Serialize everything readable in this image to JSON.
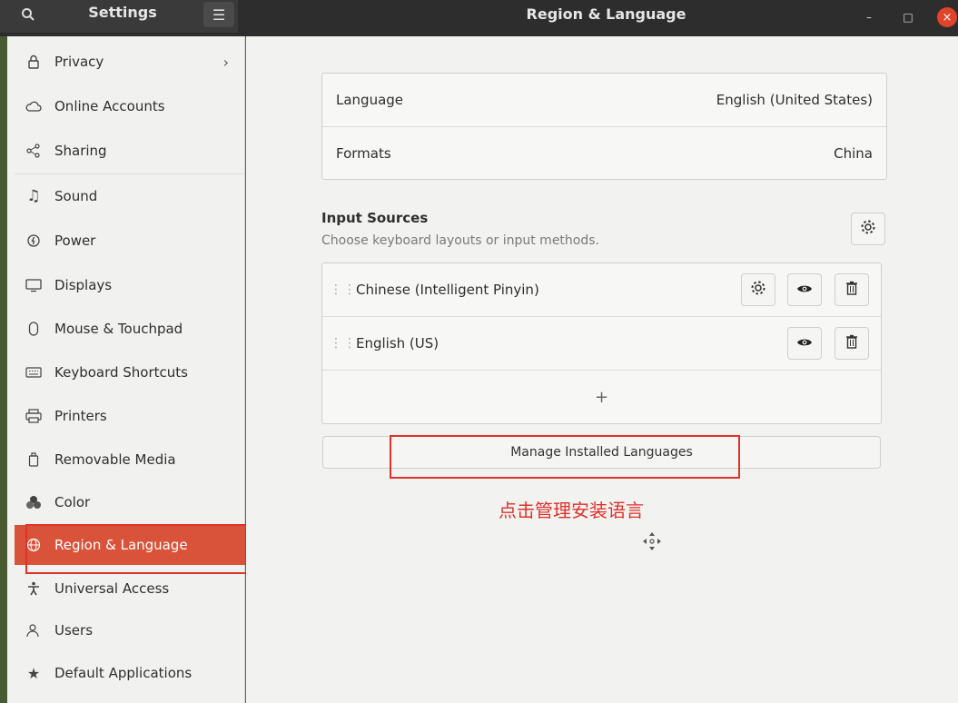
{
  "header": {
    "sidebar_title": "Settings",
    "main_title": "Region & Language",
    "search_icon": "search-icon",
    "menu_icon": "hamburger-menu-icon",
    "window_controls": {
      "minimize": "–",
      "maximize": "□",
      "close": "×"
    }
  },
  "sidebar": {
    "items": [
      {
        "label": "Privacy",
        "icon": "lock-icon"
      },
      {
        "label": "Online Accounts",
        "icon": "cloud-icon"
      },
      {
        "label": "Sharing",
        "icon": "share-icon"
      },
      {
        "label": "Sound",
        "icon": "music-note-icon"
      },
      {
        "label": "Power",
        "icon": "power-icon"
      },
      {
        "label": "Displays",
        "icon": "display-icon"
      },
      {
        "label": "Mouse & Touchpad",
        "icon": "mouse-icon"
      },
      {
        "label": "Keyboard Shortcuts",
        "icon": "keyboard-icon"
      },
      {
        "label": "Printers",
        "icon": "printer-icon"
      },
      {
        "label": "Removable Media",
        "icon": "removable-media-icon"
      },
      {
        "label": "Color",
        "icon": "color-icon"
      },
      {
        "label": "Region & Language",
        "icon": "globe-icon",
        "active": true
      },
      {
        "label": "Universal Access",
        "icon": "accessibility-icon"
      },
      {
        "label": "Users",
        "icon": "users-icon"
      },
      {
        "label": "Default Applications",
        "icon": "star-icon"
      }
    ],
    "privacy_chevron": "›"
  },
  "region": {
    "language_label": "Language",
    "language_value": "English (United States)",
    "formats_label": "Formats",
    "formats_value": "China"
  },
  "input_sources": {
    "title": "Input Sources",
    "subtitle": "Choose keyboard layouts or input methods.",
    "sources": [
      {
        "name": "Chinese (Intelligent Pinyin)",
        "has_settings": true
      },
      {
        "name": "English (US)",
        "has_settings": false
      }
    ],
    "add_label": "+"
  },
  "manage_button": "Manage Installed Languages",
  "annotation": "点击管理安装语言",
  "colors": {
    "accent": "#d9533a",
    "highlight_box": "#e0322a",
    "annotation_text": "#e0322a"
  }
}
